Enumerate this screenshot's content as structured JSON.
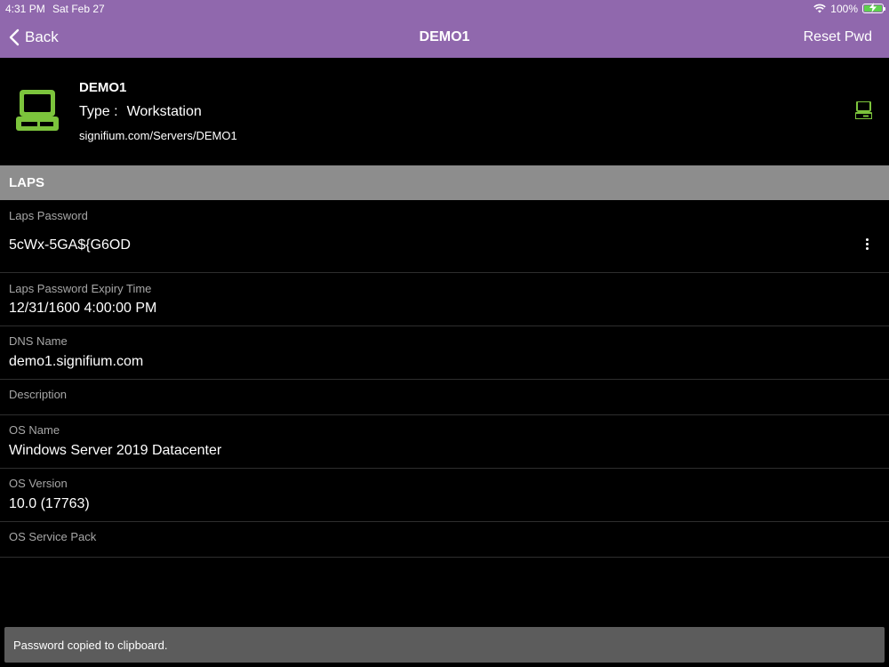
{
  "status_bar": {
    "time": "4:31 PM",
    "date": "Sat Feb 27",
    "battery_text": "100%",
    "battery_level": 1.0,
    "wifi_icon": "wifi-icon",
    "battery_color": "#5ed04e"
  },
  "nav": {
    "back_label": "Back",
    "title": "DEMO1",
    "reset_label": "Reset Pwd",
    "bar_color": "#9068ad"
  },
  "device": {
    "name": "DEMO1",
    "type_label": "Type :",
    "type_value": "Workstation",
    "path": "signifium.com/Servers/DEMO1",
    "icon": "computer-icon",
    "icon_color": "#7cc43c"
  },
  "section": {
    "title": "LAPS"
  },
  "fields": [
    {
      "label": "Laps Password",
      "value": "5cWx-5GA${G6OD"
    },
    {
      "label": "Laps Password Expiry Time",
      "value": "12/31/1600 4:00:00 PM"
    },
    {
      "label": "DNS Name",
      "value": "demo1.signifium.com"
    },
    {
      "label": "Description",
      "value": ""
    },
    {
      "label": "OS Name",
      "value": "Windows Server 2019 Datacenter"
    },
    {
      "label": "OS Version",
      "value": "10.0 (17763)"
    },
    {
      "label": "OS Service Pack",
      "value": ""
    }
  ],
  "toast": {
    "text": "Password copied to clipboard."
  }
}
